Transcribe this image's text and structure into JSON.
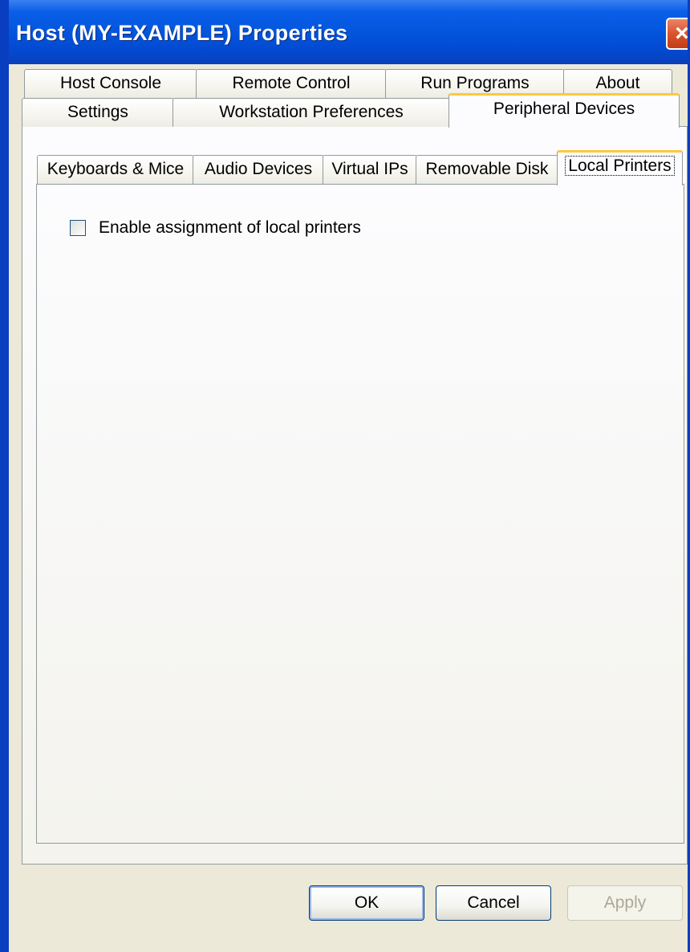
{
  "window": {
    "title": "Host (MY-EXAMPLE) Properties",
    "close_glyph": "×"
  },
  "tabs": {
    "row_back": [
      "Host Console",
      "Remote Control",
      "Run Programs",
      "About"
    ],
    "row_front": [
      "Settings",
      "Workstation Preferences",
      "Peripheral Devices"
    ],
    "active": "Peripheral Devices"
  },
  "subtabs": {
    "items": [
      "Keyboards & Mice",
      "Audio Devices",
      "Virtual IPs",
      "Removable Disk",
      "Local Printers"
    ],
    "active": "Local Printers"
  },
  "local_printers": {
    "enable_assignment_label": "Enable assignment of local printers",
    "enable_assignment_checked": false
  },
  "buttons": {
    "ok": "OK",
    "cancel": "Cancel",
    "apply": "Apply",
    "apply_enabled": false
  },
  "colors": {
    "titlebar": "#0355dc",
    "window_face": "#ece9d8",
    "active_tab_highlight": "#ffc83c",
    "close_button": "#d8542e"
  }
}
